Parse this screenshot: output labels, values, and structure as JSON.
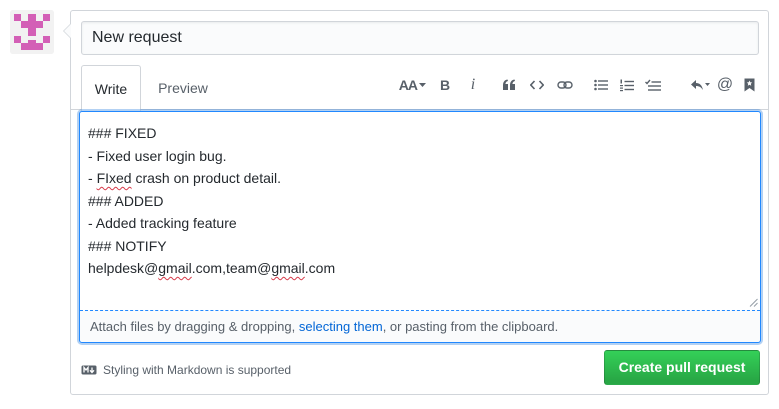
{
  "avatar": {
    "alt": "user avatar",
    "color": "#d35fb6"
  },
  "title_field": {
    "value": "New request"
  },
  "tabs": [
    {
      "label": "Write",
      "selected": true
    },
    {
      "label": "Preview",
      "selected": false
    }
  ],
  "toolbar": {
    "heading": "AA",
    "bold": "B",
    "italic": "i",
    "icons": [
      "text-size-icon",
      "bold-icon",
      "italic-icon",
      "quote-icon",
      "code-icon",
      "link-icon",
      "bullet-list-icon",
      "numbered-list-icon",
      "task-list-icon",
      "reply-icon",
      "mention-icon",
      "bookmark-icon"
    ]
  },
  "editor": {
    "lines": [
      "### FIXED",
      "- Fixed user login bug.",
      "- FIxed crash on product detail.",
      "### ADDED",
      "- Added tracking feature",
      "### NOTIFY",
      "helpdesk@gmail.com,team@gmail.com"
    ],
    "line3_prefix": "- ",
    "line3_misspelled": "FIxed",
    "line3_suffix": " crash on product detail.",
    "line7_a": "helpdesk@",
    "line7_b": "gmail",
    "line7_c": ".com,team@",
    "line7_d": "gmail",
    "line7_e": ".com"
  },
  "dropzone": {
    "before": "Attach files by dragging & dropping, ",
    "link": "selecting them",
    "after": ", or pasting from the clipboard."
  },
  "footer": {
    "markdown_note": "Styling with Markdown is supported"
  },
  "actions": {
    "create_label": "Create pull request"
  },
  "colors": {
    "accent_blue": "#2188ff",
    "link_blue": "#0366d6",
    "button_green": "#2ea44f",
    "spell_red": "#d73a49"
  }
}
